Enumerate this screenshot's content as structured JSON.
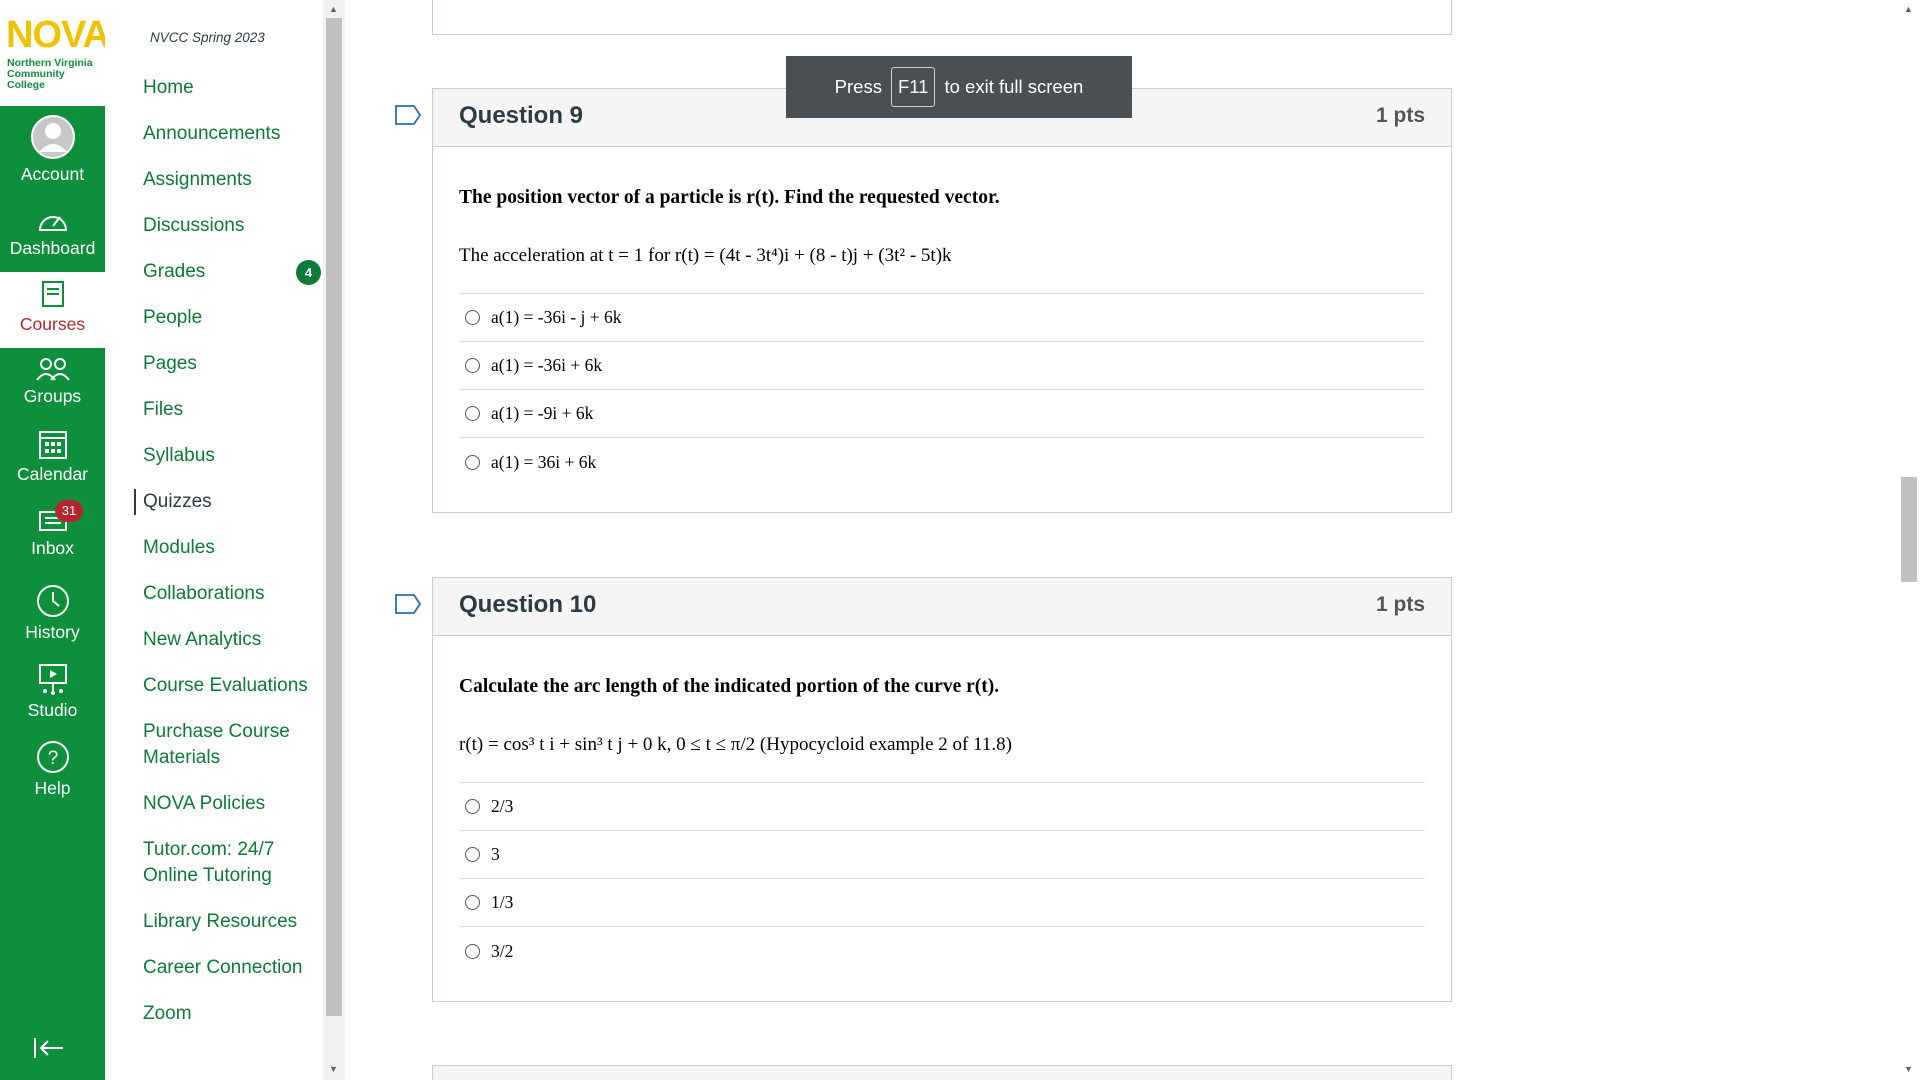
{
  "brand": {
    "logo_word": "NOVA",
    "logo_sub": "Northern Virginia Community College",
    "accent": "#0d8f3c",
    "logo_color": "#f2c200"
  },
  "global_nav": {
    "items": [
      {
        "label": "Account",
        "icon": "avatar-icon"
      },
      {
        "label": "Dashboard",
        "icon": "dashboard-icon"
      },
      {
        "label": "Courses",
        "icon": "courses-icon"
      },
      {
        "label": "Groups",
        "icon": "groups-icon"
      },
      {
        "label": "Calendar",
        "icon": "calendar-icon"
      },
      {
        "label": "Inbox",
        "icon": "inbox-icon",
        "badge": "31"
      },
      {
        "label": "History",
        "icon": "history-icon"
      },
      {
        "label": "Studio",
        "icon": "studio-icon"
      },
      {
        "label": "Help",
        "icon": "help-icon"
      }
    ]
  },
  "course_nav": {
    "term": "NVCC Spring 2023",
    "items": [
      {
        "label": "Home"
      },
      {
        "label": "Announcements"
      },
      {
        "label": "Assignments"
      },
      {
        "label": "Discussions"
      },
      {
        "label": "Grades",
        "badge": "4"
      },
      {
        "label": "People"
      },
      {
        "label": "Pages"
      },
      {
        "label": "Files"
      },
      {
        "label": "Syllabus"
      },
      {
        "label": "Quizzes",
        "active": true
      },
      {
        "label": "Modules"
      },
      {
        "label": "Collaborations"
      },
      {
        "label": "New Analytics"
      },
      {
        "label": "Course Evaluations"
      },
      {
        "label": "Purchase Course Materials"
      },
      {
        "label": "NOVA Policies"
      },
      {
        "label": "Tutor.com: 24/7 Online Tutoring"
      },
      {
        "label": "Library Resources"
      },
      {
        "label": "Career Connection"
      },
      {
        "label": "Zoom"
      }
    ]
  },
  "toast": {
    "press": "Press",
    "key": "F11",
    "rest": "to exit full screen"
  },
  "questions": [
    {
      "title": "Question 9",
      "pts": "1 pts",
      "prompt": "The position vector of a particle is r(t). Find the requested vector.",
      "sub": "The acceleration at t = 1 for r(t) = (4t - 3t⁴)i + (8 - t)j + (3t² - 5t)k",
      "answers": [
        "a(1) = -36i - j + 6k",
        "a(1) = -36i + 6k",
        "a(1) = -9i + 6k",
        "a(1) = 36i + 6k"
      ]
    },
    {
      "title": "Question 10",
      "pts": "1 pts",
      "prompt": "Calculate the arc length of the indicated portion of the curve r(t).",
      "sub": "r(t) = cos³ t i + sin³ t j + 0 k, 0 ≤ t ≤ π/2 (Hypocycloid example 2 of 11.8)",
      "answers": [
        "2/3",
        "3",
        "1/3",
        "3/2"
      ]
    }
  ]
}
